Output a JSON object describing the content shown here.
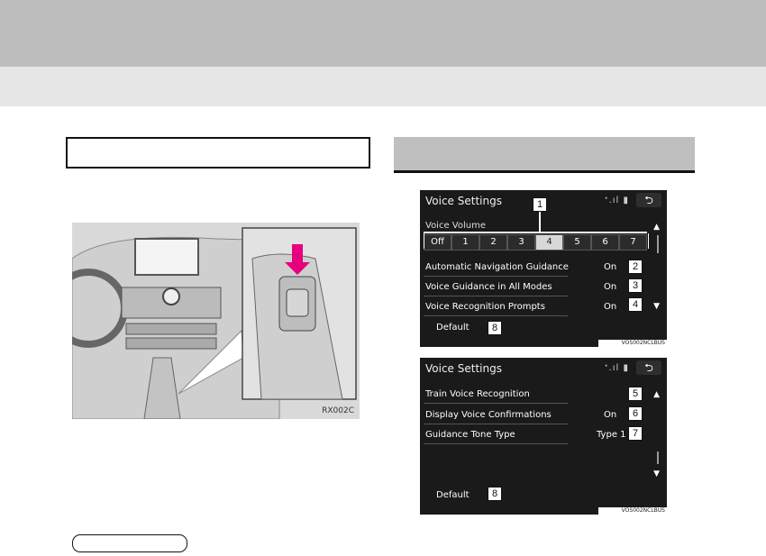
{
  "photo": {
    "code": "RX002C"
  },
  "screen1": {
    "title": "Voice Settings",
    "status": "ᐩ.ıl ▮",
    "back": "⮌",
    "voice_volume_label": "Voice Volume",
    "volume_options": [
      "Off",
      "1",
      "2",
      "3",
      "4",
      "5",
      "6",
      "7"
    ],
    "selected_volume": "4",
    "rows": [
      {
        "label": "Automatic Navigation Guidance",
        "value": "On",
        "callout": "2"
      },
      {
        "label": "Voice Guidance in All Modes",
        "value": "On",
        "callout": "3"
      },
      {
        "label": "Voice Recognition Prompts",
        "value": "On",
        "callout": "4"
      }
    ],
    "default_label": "Default",
    "default_callout": "8",
    "volume_callout": "1",
    "code": "VOS002NCLBUS"
  },
  "screen2": {
    "title": "Voice Settings",
    "status": "ᐩ.ıl ▮",
    "back": "⮌",
    "rows": [
      {
        "label": "Train Voice Recognition",
        "value": "",
        "callout": "5"
      },
      {
        "label": "Display Voice Confirmations",
        "value": "On",
        "callout": "6"
      },
      {
        "label": "Guidance Tone Type",
        "value": "Type 1",
        "callout": "7"
      }
    ],
    "default_label": "Default",
    "default_callout": "8",
    "code": "VOS002NCLBUS"
  }
}
